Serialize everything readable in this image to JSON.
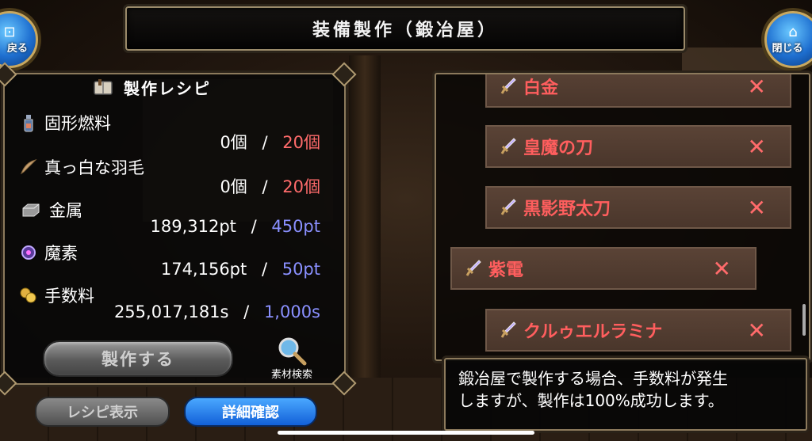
{
  "header": {
    "title": "装備製作（鍛冶屋）",
    "back_label": "戻る",
    "close_label": "閉じる"
  },
  "recipe": {
    "title": "製作レシピ",
    "materials": [
      {
        "name": "固形燃料",
        "icon": "fuel-bottle-icon",
        "owned": "0個",
        "sep": "/",
        "required": "20個",
        "required_color": "#ff6b6b"
      },
      {
        "name": "真っ白な羽毛",
        "icon": "feather-icon",
        "owned": "0個",
        "sep": "/",
        "required": "20個",
        "required_color": "#ff6b6b"
      },
      {
        "name": "金属",
        "icon": "metal-ingot-icon",
        "owned": "189,312pt",
        "sep": "/",
        "required": "450pt",
        "required_color": "#8a90ff"
      },
      {
        "name": "魔素",
        "icon": "magic-orb-icon",
        "owned": "174,156pt",
        "sep": "/",
        "required": "50pt",
        "required_color": "#8a90ff"
      },
      {
        "name": "手数料",
        "icon": "coins-icon",
        "owned": "255,017,181s",
        "sep": "/",
        "required": "1,000s",
        "required_color": "#8a90ff"
      }
    ],
    "make_button": "製作する",
    "search_label": "素材検索"
  },
  "bottom_buttons": {
    "recipe_display": "レシピ表示",
    "detail_check": "詳細確認"
  },
  "item_list": [
    {
      "name": "白金",
      "icon": "sword-icon"
    },
    {
      "name": "皇魔の刀",
      "icon": "sword-icon"
    },
    {
      "name": "黒影野太刀",
      "icon": "sword-icon"
    },
    {
      "name": "紫電",
      "icon": "sword-icon"
    },
    {
      "name": "クルゥエルラミナ",
      "icon": "sword-icon"
    }
  ],
  "info": {
    "line1": "鍛冶屋で製作する場合、手数料が発生",
    "line2": "しますが、製作は100%成功します。"
  },
  "colors": {
    "accent_red": "#ff6b6b",
    "accent_blue": "#8a90ff",
    "item_bg": "#4a362b"
  }
}
